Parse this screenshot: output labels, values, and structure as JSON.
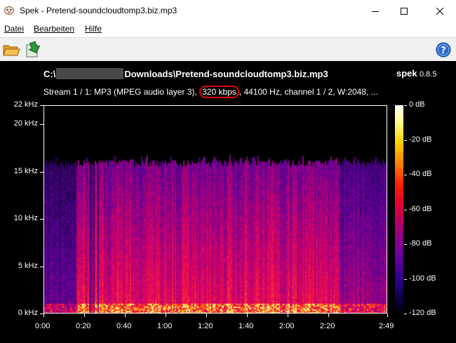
{
  "window": {
    "title": "Spek - Pretend-soundcloudtomp3.biz.mp3",
    "icon": "spek-app-icon",
    "controls": [
      "minimize",
      "maximize",
      "close"
    ]
  },
  "menu": {
    "items": [
      {
        "label": "Datei"
      },
      {
        "label": "Bearbeiten"
      },
      {
        "label": "Hilfe"
      }
    ]
  },
  "toolbar": {
    "open_icon": "folder-open-icon",
    "save_icon": "save-icon",
    "help_icon": "help-icon"
  },
  "header": {
    "path_prefix": "C:\\",
    "path_suffix": "Downloads\\Pretend-soundcloudtomp3.biz.mp3",
    "brand_name": "spek",
    "brand_version": "0.8.5",
    "stream_before": "Stream 1 / 1: MP3 (MPEG audio layer 3), ",
    "stream_bitrate": "320 kbps",
    "stream_after": ", 44100 Hz, channel 1 / 2, W:2048, ..."
  },
  "axes": {
    "y_ticks": [
      {
        "label": "22 kHz",
        "value": 22
      },
      {
        "label": "20 kHz",
        "value": 20
      },
      {
        "label": "15 kHz",
        "value": 15
      },
      {
        "label": "10 kHz",
        "value": 10
      },
      {
        "label": "5 kHz",
        "value": 5
      },
      {
        "label": "0 kHz",
        "value": 0
      }
    ],
    "x_ticks": [
      {
        "label": "0:00",
        "value": 0
      },
      {
        "label": "0:20",
        "value": 20
      },
      {
        "label": "0:40",
        "value": 40
      },
      {
        "label": "1:00",
        "value": 60
      },
      {
        "label": "1:20",
        "value": 80
      },
      {
        "label": "1:40",
        "value": 100
      },
      {
        "label": "2:00",
        "value": 120
      },
      {
        "label": "2:20",
        "value": 140
      },
      {
        "label": "2:49",
        "value": 169
      }
    ],
    "db_ticks": [
      {
        "label": "0 dB",
        "value": 0
      },
      {
        "label": "-20 dB",
        "value": -20
      },
      {
        "label": "-40 dB",
        "value": -40
      },
      {
        "label": "-60 dB",
        "value": -60
      },
      {
        "label": "-80 dB",
        "value": -80
      },
      {
        "label": "-100 dB",
        "value": -100
      },
      {
        "label": "-120 dB",
        "value": -120
      }
    ],
    "y_max_khz": 22,
    "duration_s": 169,
    "cutoff_khz": 16
  },
  "colors": {
    "background": "#000000",
    "highlight": "#e00000",
    "text": "#ffffff"
  }
}
